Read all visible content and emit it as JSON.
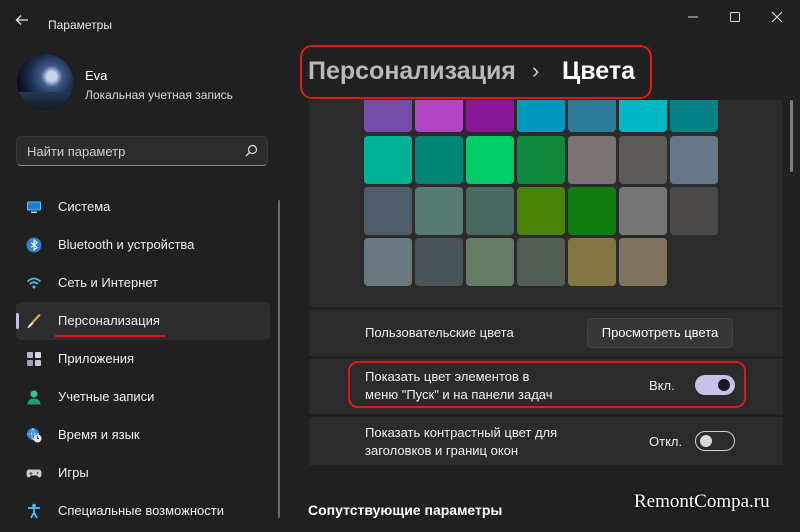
{
  "window": {
    "title": "Параметры"
  },
  "user": {
    "name": "Eva",
    "account_type": "Локальная учетная запись"
  },
  "search": {
    "placeholder": "Найти параметр"
  },
  "sidebar": {
    "items": [
      {
        "label": "Система",
        "icon": "monitor-icon"
      },
      {
        "label": "Bluetooth и устройства",
        "icon": "bluetooth-icon"
      },
      {
        "label": "Сеть и Интернет",
        "icon": "wifi-icon"
      },
      {
        "label": "Персонализация",
        "icon": "brush-icon",
        "active": true
      },
      {
        "label": "Приложения",
        "icon": "apps-icon"
      },
      {
        "label": "Учетные записи",
        "icon": "person-icon"
      },
      {
        "label": "Время и язык",
        "icon": "globe-clock-icon"
      },
      {
        "label": "Игры",
        "icon": "gamepad-icon"
      },
      {
        "label": "Специальные возможности",
        "icon": "accessibility-icon"
      }
    ]
  },
  "breadcrumb": {
    "parent": "Персонализация",
    "separator": "›",
    "current": "Цвета"
  },
  "colors": {
    "grid": [
      [
        "#744da9",
        "#b146c2",
        "#881798",
        "#0099bc",
        "#2d7d9a",
        "#00b7c3",
        "#038387"
      ],
      [
        "#00b294",
        "#018574",
        "#00cc6a",
        "#10893e",
        "#7a7574",
        "#5d5a58",
        "#68768a"
      ],
      [
        "#515c6b",
        "#567c73",
        "#486860",
        "#498205",
        "#107c10",
        "#767676",
        "#4c4a48"
      ],
      [
        "#69797e",
        "#4a5459",
        "#647c64",
        "#525e54",
        "#847545",
        "#7e735f"
      ]
    ]
  },
  "custom_colors": {
    "label": "Пользовательские цвета",
    "button": "Просмотреть цвета"
  },
  "start_taskbar": {
    "label_line1": "Показать цвет элементов в",
    "label_line2": "меню \"Пуск\" и на панели задач",
    "state": "Вкл.",
    "on": true
  },
  "contrast": {
    "label_line1": "Показать контрастный цвет для",
    "label_line2": "заголовков и границ окон",
    "state": "Откл.",
    "on": false
  },
  "related": {
    "title": "Сопутствующие параметры"
  },
  "watermark": "RemontCompa.ru",
  "accent": {
    "highlight": "#e01818",
    "toggle_on": "#c9c0ec"
  }
}
